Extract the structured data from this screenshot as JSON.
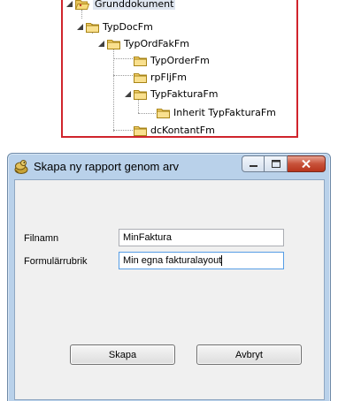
{
  "tree": {
    "items": [
      {
        "label": "Grunddokument",
        "icon": "open-folder-icon",
        "expanded": true,
        "selected": true
      },
      {
        "label": "TypDocFm",
        "icon": "folder-icon",
        "expanded": true
      },
      {
        "label": "TypOrdFakFm",
        "icon": "folder-icon",
        "expanded": true
      },
      {
        "label": "TypOrderFm",
        "icon": "folder-icon"
      },
      {
        "label": "rpFljFm",
        "icon": "folder-icon"
      },
      {
        "label": "TypFakturaFm",
        "icon": "folder-icon",
        "expanded": true
      },
      {
        "label": "Inherit TypFakturaFm",
        "icon": "folder-icon"
      },
      {
        "label": "dcKontantFm",
        "icon": "folder-icon"
      }
    ],
    "border_color": "#d0242c"
  },
  "dialog": {
    "title": "Skapa ny rapport genom arv",
    "fields": {
      "filename": {
        "label": "Filnamn",
        "value": "MinFaktura"
      },
      "heading": {
        "label": "Formulärrubrik",
        "value": "Min egna fakturalayout"
      }
    },
    "buttons": {
      "create": "Skapa",
      "cancel": "Avbryt"
    }
  }
}
